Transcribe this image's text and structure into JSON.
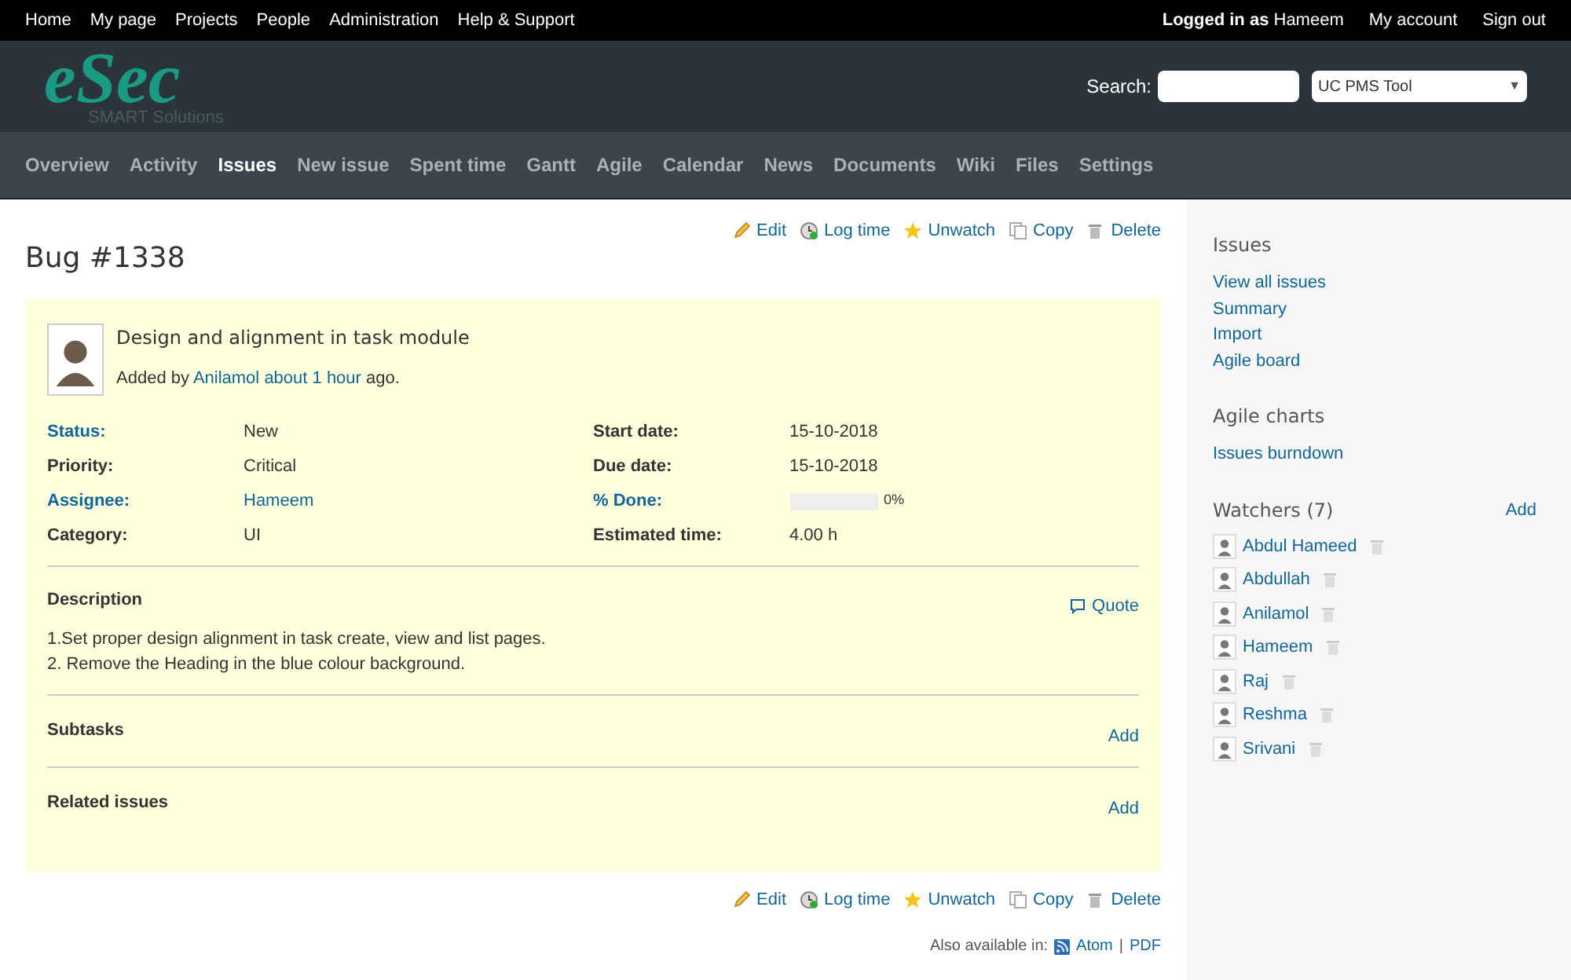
{
  "top_menu": {
    "links": [
      "Home",
      "My page",
      "Projects",
      "People",
      "Administration",
      "Help & Support"
    ],
    "logged_in_label": "Logged in as",
    "logged_in_user": "Hameem",
    "account_links": [
      "My account",
      "Sign out"
    ]
  },
  "header": {
    "logo": "eSec",
    "logo_tagline": "SMART Solutions",
    "search_label": "Search:",
    "project_select": "UC PMS Tool",
    "select_caret": "▼"
  },
  "main_menu": [
    {
      "label": "Overview",
      "selected": false
    },
    {
      "label": "Activity",
      "selected": false
    },
    {
      "label": "Issues",
      "selected": true
    },
    {
      "label": "New issue",
      "selected": false
    },
    {
      "label": "Spent time",
      "selected": false
    },
    {
      "label": "Gantt",
      "selected": false
    },
    {
      "label": "Agile",
      "selected": false
    },
    {
      "label": "Calendar",
      "selected": false
    },
    {
      "label": "News",
      "selected": false
    },
    {
      "label": "Documents",
      "selected": false
    },
    {
      "label": "Wiki",
      "selected": false
    },
    {
      "label": "Files",
      "selected": false
    },
    {
      "label": "Settings",
      "selected": false
    }
  ],
  "issue": {
    "title": "Bug #1338",
    "actions": [
      {
        "kind": "edit",
        "label": "Edit"
      },
      {
        "kind": "log",
        "label": "Log time"
      },
      {
        "kind": "watch",
        "label": "Unwatch"
      },
      {
        "kind": "copy",
        "label": "Copy"
      },
      {
        "kind": "delete",
        "label": "Delete"
      }
    ],
    "subject": "Design and alignment in task module",
    "added_prefix": "Added by",
    "author": "Anilamol",
    "age": "about 1 hour",
    "added_suffix": "ago.",
    "attributes_left": [
      {
        "label": "Status:",
        "value": "New",
        "label_link": true,
        "value_link": false
      },
      {
        "label": "Priority:",
        "value": "Critical",
        "label_link": false,
        "value_link": false
      },
      {
        "label": "Assignee:",
        "value": "Hameem",
        "label_link": true,
        "value_link": true
      },
      {
        "label": "Category:",
        "value": "UI",
        "label_link": false,
        "value_link": false
      }
    ],
    "attributes_right": [
      {
        "kind": "text",
        "label": "Start date:",
        "value": "15-10-2018",
        "label_link": false
      },
      {
        "kind": "text",
        "label": "Due date:",
        "value": "15-10-2018",
        "label_link": false
      },
      {
        "kind": "progress",
        "label": "% Done:",
        "value": "0%",
        "level": 0,
        "label_link": true
      },
      {
        "kind": "text",
        "label": "Estimated time:",
        "value": "4.00 h",
        "label_link": false
      }
    ],
    "description": {
      "heading": "Description",
      "quote": "Quote",
      "lines": [
        "1.Set proper design alignment in task create, view and list pages.",
        "2. Remove the Heading in the blue colour background."
      ]
    },
    "sections": [
      {
        "heading": "Subtasks",
        "action": "Add"
      },
      {
        "heading": "Related issues",
        "action": "Add"
      }
    ],
    "bottom_actions": [
      {
        "kind": "edit",
        "label": "Edit"
      },
      {
        "kind": "log",
        "label": "Log time"
      },
      {
        "kind": "watch",
        "label": "Unwatch"
      },
      {
        "kind": "copy",
        "label": "Copy"
      },
      {
        "kind": "delete",
        "label": "Delete"
      }
    ],
    "also_available": "Also available in:",
    "formats": [
      "Atom",
      "PDF"
    ],
    "format_separator": "|"
  },
  "sidebar": {
    "issues_heading": "Issues",
    "issues_links": [
      "View all issues",
      "Summary",
      "Import",
      "Agile board"
    ],
    "charts_heading": "Agile charts",
    "charts_links": [
      "Issues burndown"
    ],
    "watchers_heading": "Watchers (7)",
    "watchers_add": "Add",
    "watchers": [
      {
        "name": "Abdul Hameed"
      },
      {
        "name": "Abdullah"
      },
      {
        "name": "Anilamol"
      },
      {
        "name": "Hameem"
      },
      {
        "name": "Raj"
      },
      {
        "name": "Reshma"
      },
      {
        "name": "Srivani"
      }
    ]
  }
}
